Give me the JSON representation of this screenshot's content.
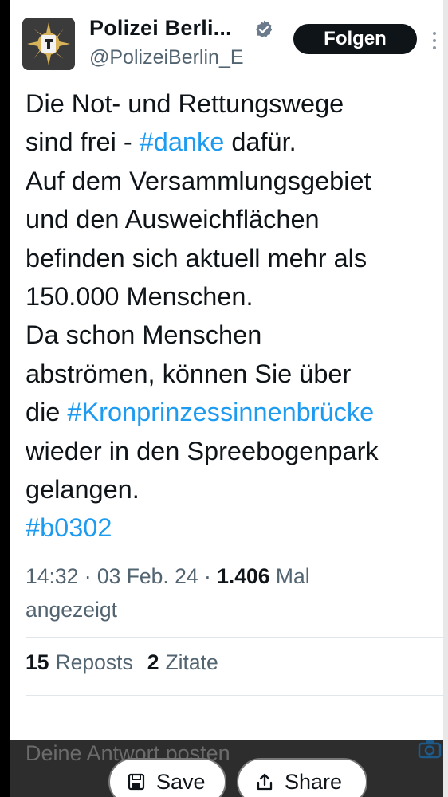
{
  "account": {
    "name": "Polizei Berli...",
    "handle": "@PolizeiBerlin_E",
    "follow_label": "Folgen"
  },
  "tweet": {
    "lines": [
      [
        {
          "t": "Die Not- und Rettungswege",
          "tag": false
        }
      ],
      [
        {
          "t": "sind frei - ",
          "tag": false
        },
        {
          "t": "#danke",
          "tag": true
        },
        {
          "t": " dafür.",
          "tag": false
        }
      ],
      [
        {
          "t": "Auf dem Versammlungsgebiet",
          "tag": false
        }
      ],
      [
        {
          "t": "und den Ausweichflächen",
          "tag": false
        }
      ],
      [
        {
          "t": "befinden sich aktuell mehr als",
          "tag": false
        }
      ],
      [
        {
          "t": "150.000 Menschen.",
          "tag": false
        }
      ],
      [
        {
          "t": "Da schon Menschen",
          "tag": false
        }
      ],
      [
        {
          "t": "abströmen, können Sie über",
          "tag": false
        }
      ],
      [
        {
          "t": "die ",
          "tag": false
        },
        {
          "t": "#Kronprinzessinnenbrücke",
          "tag": true
        }
      ],
      [
        {
          "t": "wieder in den Spreebogenpark",
          "tag": false
        }
      ],
      [
        {
          "t": "gelangen.",
          "tag": false
        }
      ],
      [
        {
          "t": "#b0302",
          "tag": true
        }
      ]
    ],
    "colors": {
      "text": "#0f1419",
      "hashtag": "#1d9bf0",
      "muted": "#536471"
    }
  },
  "meta": {
    "time": "14:32",
    "sep": "·",
    "date": "03 Feb. 24",
    "views_count": "1.406",
    "views_label_1": "Mal",
    "views_label_2": "angezeigt"
  },
  "stats": {
    "reposts_count": "15",
    "reposts_label": "Reposts",
    "quotes_count": "2",
    "quotes_label": "Zitate"
  },
  "reply": {
    "placeholder": "Deine Antwort posten"
  },
  "actions": {
    "save_label": "Save",
    "share_label": "Share"
  },
  "icons": [
    "berlin-bear-logo-icon",
    "verified-badge-icon",
    "more-options-icon",
    "camera-icon",
    "save-icon",
    "share-icon"
  ]
}
